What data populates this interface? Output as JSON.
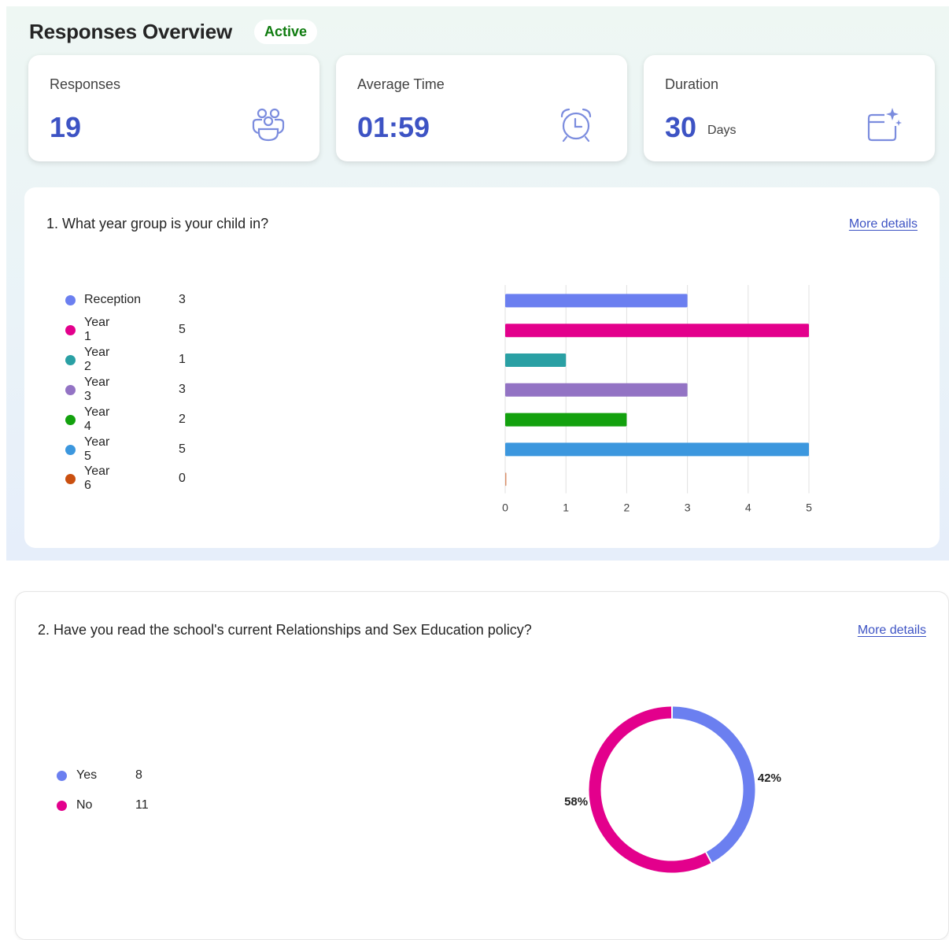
{
  "header": {
    "title": "Responses Overview",
    "status": "Active"
  },
  "stats": [
    {
      "label": "Responses",
      "value": "19",
      "unit": "",
      "icon": "group-icon"
    },
    {
      "label": "Average Time",
      "value": "01:59",
      "unit": "",
      "icon": "alarm-clock-icon"
    },
    {
      "label": "Duration",
      "value": "30",
      "unit": "Days",
      "icon": "calendar-sparkle-icon"
    }
  ],
  "questions": [
    {
      "title": "1. What year group is your child in?",
      "more_details": "More details",
      "legend": [
        {
          "label": "Reception",
          "count": "3",
          "color": "#6b7ff0"
        },
        {
          "label": "Year 1",
          "count": "5",
          "color": "#e3008c"
        },
        {
          "label": "Year 2",
          "count": "1",
          "color": "#2aa0a4"
        },
        {
          "label": "Year 3",
          "count": "3",
          "color": "#9373c4"
        },
        {
          "label": "Year 4",
          "count": "2",
          "color": "#13a10e"
        },
        {
          "label": "Year 5",
          "count": "5",
          "color": "#3c97de"
        },
        {
          "label": "Year 6",
          "count": "0",
          "color": "#ca5010"
        }
      ]
    },
    {
      "title": "2. Have you read the school's current Relationships and Sex Education policy?",
      "more_details": "More details",
      "legend": [
        {
          "label": "Yes",
          "count": "8",
          "color": "#6b7ff0"
        },
        {
          "label": "No",
          "count": "11",
          "color": "#e3008c"
        }
      ]
    }
  ],
  "chart_data": [
    {
      "type": "bar",
      "orientation": "horizontal",
      "categories": [
        "Reception",
        "Year 1",
        "Year 2",
        "Year 3",
        "Year 4",
        "Year 5",
        "Year 6"
      ],
      "values": [
        3,
        5,
        1,
        3,
        2,
        5,
        0
      ],
      "colors": [
        "#6b7ff0",
        "#e3008c",
        "#2aa0a4",
        "#9373c4",
        "#13a10e",
        "#3c97de",
        "#ca5010"
      ],
      "xlim": [
        0,
        5
      ],
      "xticks": [
        "0",
        "1",
        "2",
        "3",
        "4",
        "5"
      ],
      "grid": true
    },
    {
      "type": "pie",
      "donut": true,
      "categories": [
        "Yes",
        "No"
      ],
      "values": [
        8,
        11
      ],
      "labels": [
        "42%",
        "58%"
      ],
      "colors": [
        "#6b7ff0",
        "#e3008c"
      ]
    }
  ]
}
